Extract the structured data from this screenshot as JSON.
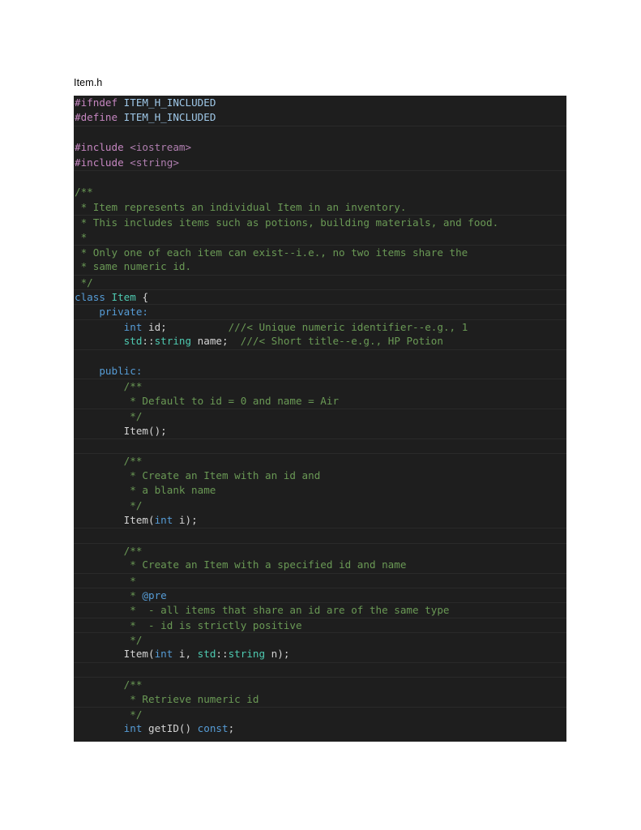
{
  "caption": "Item.h",
  "code_block": {
    "language": "cpp",
    "background_color": "#1e1e1e",
    "colors": {
      "preprocessor": "#c586c0",
      "macro": "#9fc8e8",
      "header_name": "#b07fb0",
      "comment": "#6a9955",
      "doxygen_tag": "#569cd6",
      "keyword": "#569cd6",
      "type": "#4ec9b0",
      "plain": "#d4d4d4"
    },
    "lines": [
      {
        "sep": false,
        "band": false,
        "tokens": [
          {
            "t": "#ifndef",
            "c": "tok-pre"
          },
          {
            "t": " ",
            "c": "tok-txt"
          },
          {
            "t": "ITEM_H_INCLUDED",
            "c": "tok-macro"
          }
        ]
      },
      {
        "sep": false,
        "band": false,
        "tokens": [
          {
            "t": "#define",
            "c": "tok-pre"
          },
          {
            "t": " ",
            "c": "tok-txt"
          },
          {
            "t": "ITEM_H_INCLUDED",
            "c": "tok-macro"
          }
        ]
      },
      {
        "sep": true,
        "band": false,
        "tokens": []
      },
      {
        "sep": false,
        "band": false,
        "tokens": [
          {
            "t": "#include",
            "c": "tok-pre"
          },
          {
            "t": " ",
            "c": "tok-txt"
          },
          {
            "t": "<iostream>",
            "c": "tok-hdr"
          }
        ]
      },
      {
        "sep": false,
        "band": false,
        "tokens": [
          {
            "t": "#include",
            "c": "tok-pre"
          },
          {
            "t": " ",
            "c": "tok-txt"
          },
          {
            "t": "<string>",
            "c": "tok-hdr"
          }
        ]
      },
      {
        "sep": true,
        "band": false,
        "tokens": []
      },
      {
        "sep": false,
        "band": false,
        "tokens": [
          {
            "t": "/**",
            "c": "tok-cmt"
          }
        ]
      },
      {
        "sep": false,
        "band": false,
        "tokens": [
          {
            "t": " * Item represents an individual Item in an inventory.",
            "c": "tok-cmt"
          }
        ]
      },
      {
        "sep": true,
        "band": false,
        "tokens": [
          {
            "t": " * This includes items such as potions, building materials, and food.",
            "c": "tok-cmt"
          }
        ]
      },
      {
        "sep": false,
        "band": false,
        "tokens": [
          {
            "t": " *",
            "c": "tok-cmt"
          }
        ]
      },
      {
        "sep": true,
        "band": false,
        "tokens": [
          {
            "t": " * Only one of each item can exist--i.e., no two items share the",
            "c": "tok-cmt"
          }
        ]
      },
      {
        "sep": false,
        "band": false,
        "tokens": [
          {
            "t": " * same numeric id.",
            "c": "tok-cmt"
          }
        ]
      },
      {
        "sep": true,
        "band": false,
        "tokens": [
          {
            "t": " */",
            "c": "tok-cmt"
          }
        ]
      },
      {
        "sep": true,
        "band": false,
        "tokens": [
          {
            "t": "class",
            "c": "tok-kw"
          },
          {
            "t": " ",
            "c": "tok-txt"
          },
          {
            "t": "Item",
            "c": "tok-type"
          },
          {
            "t": " {",
            "c": "tok-txt"
          }
        ]
      },
      {
        "sep": true,
        "band": false,
        "tokens": [
          {
            "t": "    ",
            "c": "tok-txt"
          },
          {
            "t": "private:",
            "c": "tok-kw"
          }
        ]
      },
      {
        "sep": true,
        "band": false,
        "tokens": [
          {
            "t": "        ",
            "c": "tok-txt"
          },
          {
            "t": "int",
            "c": "tok-kw"
          },
          {
            "t": " id;          ",
            "c": "tok-txt"
          },
          {
            "t": "///< Unique numeric identifier--e.g., 1",
            "c": "tok-cmt"
          }
        ]
      },
      {
        "sep": false,
        "band": false,
        "tokens": [
          {
            "t": "        ",
            "c": "tok-txt"
          },
          {
            "t": "std",
            "c": "tok-type"
          },
          {
            "t": "::",
            "c": "tok-txt"
          },
          {
            "t": "string",
            "c": "tok-type"
          },
          {
            "t": " name;  ",
            "c": "tok-txt"
          },
          {
            "t": "///< Short title--e.g., HP Potion",
            "c": "tok-cmt"
          }
        ]
      },
      {
        "sep": true,
        "band": false,
        "tokens": []
      },
      {
        "sep": false,
        "band": false,
        "tokens": [
          {
            "t": "    ",
            "c": "tok-txt"
          },
          {
            "t": "public:",
            "c": "tok-kw"
          }
        ]
      },
      {
        "sep": true,
        "band": false,
        "tokens": [
          {
            "t": "        ",
            "c": "tok-txt"
          },
          {
            "t": "/**",
            "c": "tok-cmt"
          }
        ]
      },
      {
        "sep": false,
        "band": false,
        "tokens": [
          {
            "t": "         * Default to id = 0 and name = Air",
            "c": "tok-cmt"
          }
        ]
      },
      {
        "sep": true,
        "band": false,
        "tokens": [
          {
            "t": "         */",
            "c": "tok-cmt"
          }
        ]
      },
      {
        "sep": false,
        "band": false,
        "tokens": [
          {
            "t": "        Item();",
            "c": "tok-txt"
          }
        ]
      },
      {
        "sep": true,
        "band": false,
        "tokens": []
      },
      {
        "sep": true,
        "band": false,
        "tokens": [
          {
            "t": "        ",
            "c": "tok-txt"
          },
          {
            "t": "/**",
            "c": "tok-cmt"
          }
        ]
      },
      {
        "sep": false,
        "band": false,
        "tokens": [
          {
            "t": "         * Create an Item with an id and",
            "c": "tok-cmt"
          }
        ]
      },
      {
        "sep": false,
        "band": false,
        "tokens": [
          {
            "t": "         * a blank name",
            "c": "tok-cmt"
          }
        ]
      },
      {
        "sep": false,
        "band": false,
        "tokens": [
          {
            "t": "         */",
            "c": "tok-cmt"
          }
        ]
      },
      {
        "sep": false,
        "band": false,
        "tokens": [
          {
            "t": "        Item(",
            "c": "tok-txt"
          },
          {
            "t": "int",
            "c": "tok-kw"
          },
          {
            "t": " i);",
            "c": "tok-txt"
          }
        ]
      },
      {
        "sep": true,
        "band": false,
        "tokens": []
      },
      {
        "sep": true,
        "band": false,
        "tokens": [
          {
            "t": "        ",
            "c": "tok-txt"
          },
          {
            "t": "/**",
            "c": "tok-cmt"
          }
        ]
      },
      {
        "sep": false,
        "band": false,
        "tokens": [
          {
            "t": "         * Create an Item with a specified id and name",
            "c": "tok-cmt"
          }
        ]
      },
      {
        "sep": true,
        "band": false,
        "tokens": [
          {
            "t": "         *",
            "c": "tok-cmt"
          }
        ]
      },
      {
        "sep": true,
        "band": false,
        "tokens": [
          {
            "t": "         * ",
            "c": "tok-cmt"
          },
          {
            "t": "@pre",
            "c": "tok-dox"
          }
        ]
      },
      {
        "sep": true,
        "band": false,
        "tokens": [
          {
            "t": "         *  - all items that share an id are of the same type",
            "c": "tok-cmt"
          }
        ]
      },
      {
        "sep": true,
        "band": false,
        "tokens": [
          {
            "t": "         *  - id is strictly positive",
            "c": "tok-cmt"
          }
        ]
      },
      {
        "sep": true,
        "band": false,
        "tokens": [
          {
            "t": "         */",
            "c": "tok-cmt"
          }
        ]
      },
      {
        "sep": false,
        "band": false,
        "tokens": [
          {
            "t": "        Item(",
            "c": "tok-txt"
          },
          {
            "t": "int",
            "c": "tok-kw"
          },
          {
            "t": " i, ",
            "c": "tok-txt"
          },
          {
            "t": "std",
            "c": "tok-type"
          },
          {
            "t": "::",
            "c": "tok-txt"
          },
          {
            "t": "string",
            "c": "tok-type"
          },
          {
            "t": " n);",
            "c": "tok-txt"
          }
        ]
      },
      {
        "sep": true,
        "band": false,
        "tokens": []
      },
      {
        "sep": true,
        "band": false,
        "tokens": [
          {
            "t": "        ",
            "c": "tok-txt"
          },
          {
            "t": "/**",
            "c": "tok-cmt"
          }
        ]
      },
      {
        "sep": false,
        "band": false,
        "tokens": [
          {
            "t": "         * Retrieve numeric id",
            "c": "tok-cmt"
          }
        ]
      },
      {
        "sep": true,
        "band": false,
        "tokens": [
          {
            "t": "         */",
            "c": "tok-cmt"
          }
        ]
      },
      {
        "sep": false,
        "band": false,
        "tokens": [
          {
            "t": "        ",
            "c": "tok-txt"
          },
          {
            "t": "int",
            "c": "tok-kw"
          },
          {
            "t": " getID() ",
            "c": "tok-txt"
          },
          {
            "t": "const",
            "c": "tok-kw"
          },
          {
            "t": ";",
            "c": "tok-txt"
          }
        ]
      }
    ]
  }
}
